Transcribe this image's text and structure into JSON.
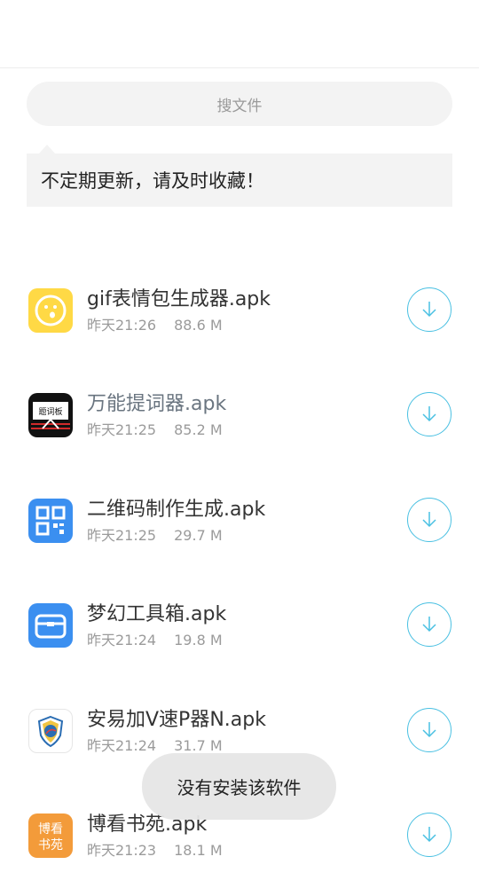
{
  "search": {
    "placeholder": "搜文件"
  },
  "notice": {
    "text": "不定期更新，请及时收藏！"
  },
  "files": [
    {
      "name": "gif表情包生成器.apk",
      "time": "昨天21:26",
      "size": "88.6 M",
      "icon": "yellow-face-icon"
    },
    {
      "name": "万能提词器.apk",
      "time": "昨天21:25",
      "size": "85.2 M",
      "icon": "teleprompter-board-icon",
      "icon_text": "题词板"
    },
    {
      "name": "二维码制作生成.apk",
      "time": "昨天21:25",
      "size": "29.7 M",
      "icon": "qr-code-icon"
    },
    {
      "name": "梦幻工具箱.apk",
      "time": "昨天21:24",
      "size": "19.8 M",
      "icon": "toolbox-icon"
    },
    {
      "name": "安易加V速P器N.apk",
      "time": "昨天21:24",
      "size": "31.7 M",
      "icon": "vpn-shield-icon"
    },
    {
      "name": "博看书苑.apk",
      "time": "昨天21:23",
      "size": "18.1 M",
      "icon": "bokan-book-icon",
      "icon_text": "博看书苑"
    }
  ],
  "toast": {
    "text": "没有安装该软件"
  },
  "colors": {
    "accent": "#49c0e2",
    "background": "#ffffff",
    "panel": "#f3f3f3"
  }
}
